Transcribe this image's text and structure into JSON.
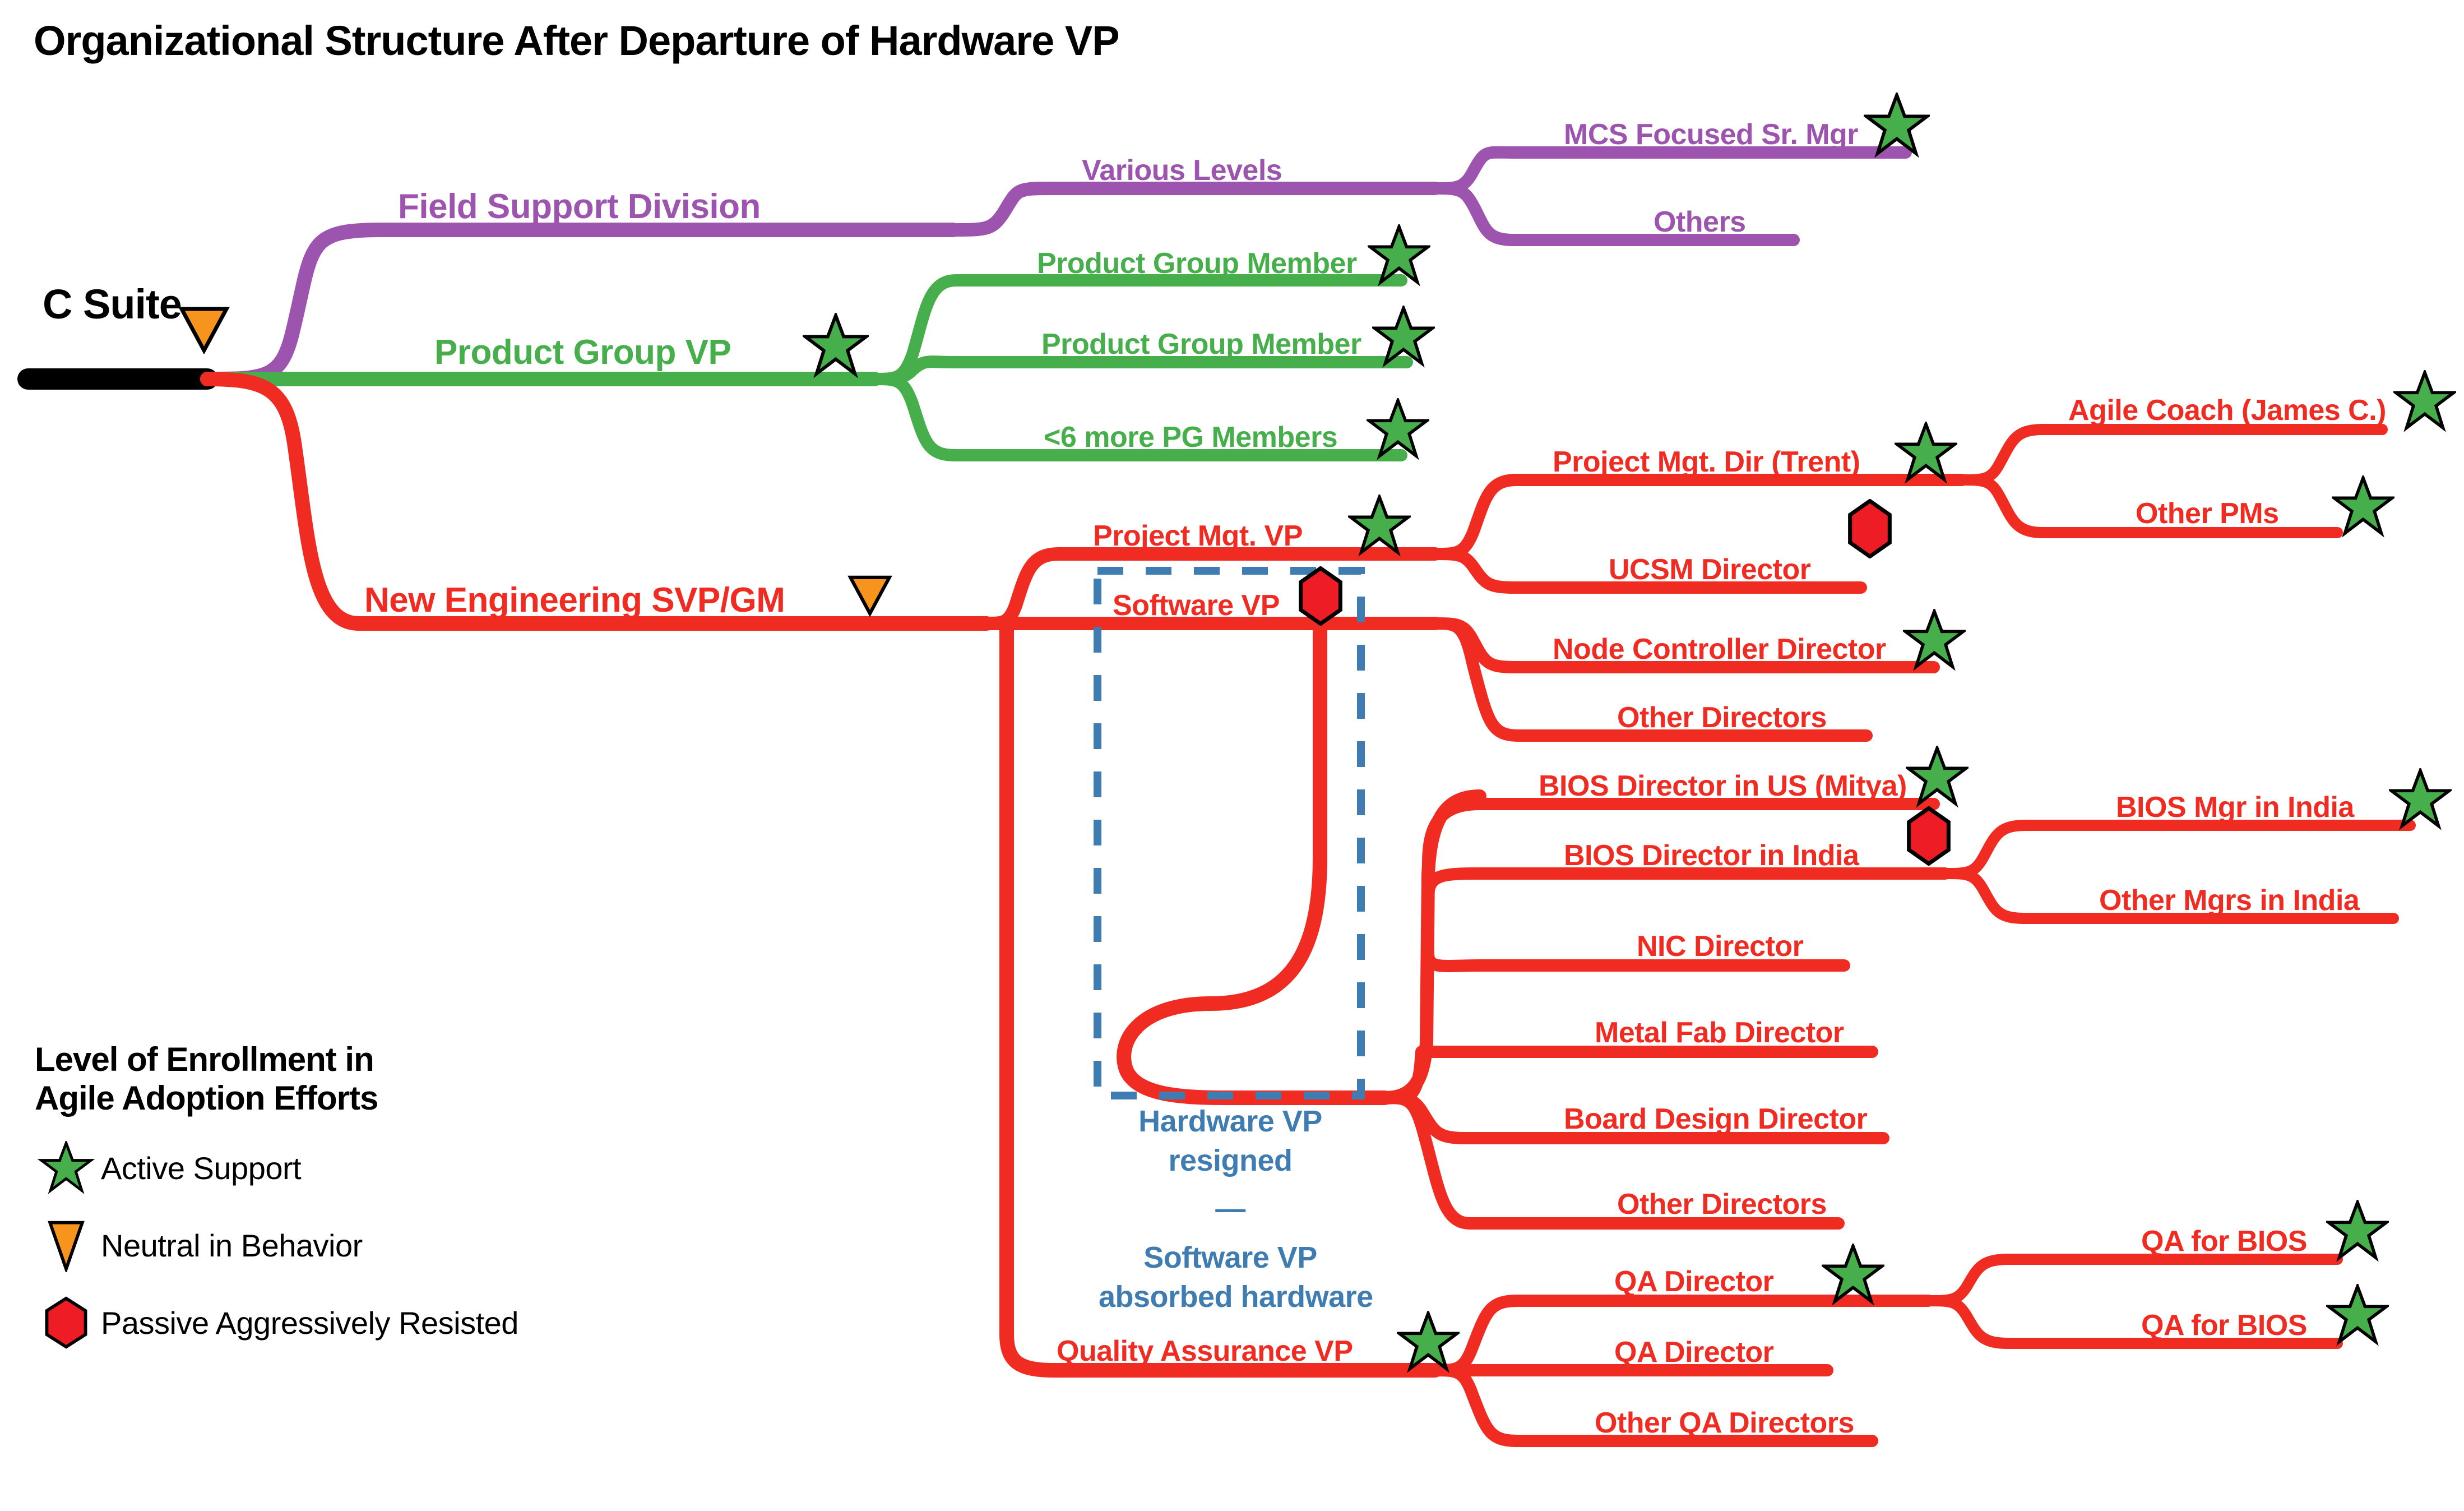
{
  "title": "Organizational Structure After Departure of Hardware VP",
  "root": {
    "label": "C Suite",
    "marker": "neutral-triangle"
  },
  "legend": {
    "title_line1": "Level of Enrollment in",
    "title_line2": "Agile Adoption Efforts",
    "items": [
      {
        "icon": "green-star-icon",
        "label": "Active Support"
      },
      {
        "icon": "orange-triangle-icon",
        "label": "Neutral in Behavior"
      },
      {
        "icon": "red-hexagon-icon",
        "label": "Passive Aggressively Resisted"
      }
    ]
  },
  "colors": {
    "purple": "#9C54AE",
    "green": "#46AE4A",
    "red": "#EF2B22",
    "black": "#000000",
    "blue": "#3E7CB1",
    "star_fill": "#46AE4A",
    "triangle_fill": "#F7941E",
    "hexagon_fill": "#EE1C25"
  },
  "annotation": {
    "line1": "Hardware VP",
    "line2": "resigned",
    "dash": "—",
    "line3": "Software VP",
    "line4": "absorbed hardware",
    "box": "dashed-highlight-box"
  },
  "branches": [
    {
      "id": "field-support-division",
      "label": "Field Support Division",
      "color": "purple",
      "marker": "none"
    },
    {
      "id": "various-levels",
      "label": "Various Levels",
      "color": "purple",
      "marker": "none"
    },
    {
      "id": "mcs-focused-sr-mgr",
      "label": "MCS Focused Sr. Mgr",
      "color": "purple",
      "marker": "star"
    },
    {
      "id": "others",
      "label": "Others",
      "color": "purple",
      "marker": "none"
    },
    {
      "id": "product-group-vp",
      "label": "Product Group VP",
      "color": "green",
      "marker": "star"
    },
    {
      "id": "product-group-member-1",
      "label": "Product Group Member",
      "color": "green",
      "marker": "star"
    },
    {
      "id": "product-group-member-2",
      "label": "Product Group Member",
      "color": "green",
      "marker": "star"
    },
    {
      "id": "more-pg-members",
      "label": "<6 more PG Members",
      "color": "green",
      "marker": "star"
    },
    {
      "id": "new-engineering-svp-gm",
      "label": "New Engineering SVP/GM",
      "color": "red",
      "marker": "triangle"
    },
    {
      "id": "project-mgt-vp",
      "label": "Project Mgt. VP",
      "color": "red",
      "marker": "star"
    },
    {
      "id": "project-mgt-dir-trent",
      "label": "Project Mgt. Dir (Trent)",
      "color": "red",
      "marker": "star"
    },
    {
      "id": "agile-coach-james-c",
      "label": "Agile Coach (James C.)",
      "color": "red",
      "marker": "star"
    },
    {
      "id": "other-pms",
      "label": "Other PMs",
      "color": "red",
      "marker": "star"
    },
    {
      "id": "ucsm-director",
      "label": "UCSM Director",
      "color": "red",
      "marker": "hexagon"
    },
    {
      "id": "software-vp",
      "label": "Software VP",
      "color": "red",
      "marker": "hexagon"
    },
    {
      "id": "node-controller-director",
      "label": "Node Controller Director",
      "color": "red",
      "marker": "star"
    },
    {
      "id": "other-directors-sw",
      "label": "Other Directors",
      "color": "red",
      "marker": "none"
    },
    {
      "id": "bios-director-us-mitya",
      "label": "BIOS Director in US (Mitya)",
      "color": "red",
      "marker": "star"
    },
    {
      "id": "bios-director-india",
      "label": "BIOS Director in India",
      "color": "red",
      "marker": "hexagon"
    },
    {
      "id": "bios-mgr-in-india",
      "label": "BIOS Mgr in India",
      "color": "red",
      "marker": "star"
    },
    {
      "id": "other-mgrs-in-india",
      "label": "Other Mgrs in India",
      "color": "red",
      "marker": "none"
    },
    {
      "id": "nic-director",
      "label": "NIC Director",
      "color": "red",
      "marker": "none"
    },
    {
      "id": "metal-fab-director",
      "label": "Metal Fab Director",
      "color": "red",
      "marker": "none"
    },
    {
      "id": "board-design-director",
      "label": "Board Design Director",
      "color": "red",
      "marker": "none"
    },
    {
      "id": "other-directors-hw",
      "label": "Other Directors",
      "color": "red",
      "marker": "none"
    },
    {
      "id": "quality-assurance-vp",
      "label": "Quality Assurance VP",
      "color": "red",
      "marker": "star"
    },
    {
      "id": "qa-director-1",
      "label": "QA Director",
      "color": "red",
      "marker": "star"
    },
    {
      "id": "qa-for-bios-1",
      "label": "QA for BIOS",
      "color": "red",
      "marker": "star"
    },
    {
      "id": "qa-for-bios-2",
      "label": "QA for BIOS",
      "color": "red",
      "marker": "star"
    },
    {
      "id": "qa-director-2",
      "label": "QA Director",
      "color": "red",
      "marker": "none"
    },
    {
      "id": "other-qa-directors",
      "label": "Other QA Directors",
      "color": "red",
      "marker": "none"
    }
  ]
}
